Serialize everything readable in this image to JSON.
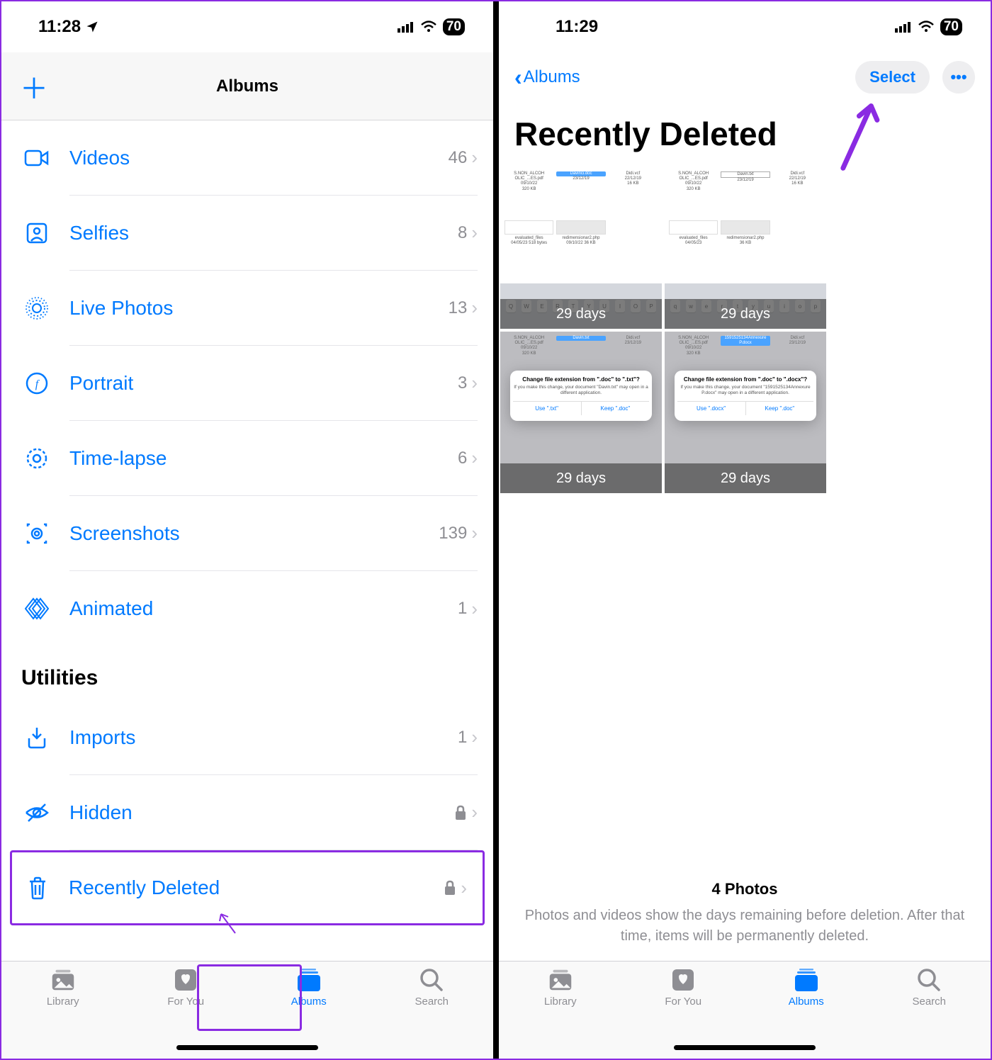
{
  "left": {
    "status": {
      "time": "11:28",
      "battery": "70"
    },
    "nav_title": "Albums",
    "media_types": [
      {
        "icon": "videos-icon",
        "label": "Videos",
        "count": "46"
      },
      {
        "icon": "selfies-icon",
        "label": "Selfies",
        "count": "8"
      },
      {
        "icon": "livephotos-icon",
        "label": "Live Photos",
        "count": "13"
      },
      {
        "icon": "portrait-icon",
        "label": "Portrait",
        "count": "3"
      },
      {
        "icon": "timelapse-icon",
        "label": "Time-lapse",
        "count": "6"
      },
      {
        "icon": "screenshots-icon",
        "label": "Screenshots",
        "count": "139"
      },
      {
        "icon": "animated-icon",
        "label": "Animated",
        "count": "1"
      }
    ],
    "section_utilities": "Utilities",
    "utilities": [
      {
        "icon": "imports-icon",
        "label": "Imports",
        "count": "1",
        "locked": false
      },
      {
        "icon": "hidden-icon",
        "label": "Hidden",
        "locked": true
      },
      {
        "icon": "trash-icon",
        "label": "Recently Deleted",
        "locked": true
      }
    ],
    "tabs": {
      "library": "Library",
      "foryou": "For You",
      "albums": "Albums",
      "search": "Search"
    }
  },
  "right": {
    "status": {
      "time": "11:29",
      "battery": "70"
    },
    "back_label": "Albums",
    "select_label": "Select",
    "title": "Recently Deleted",
    "thumbs": [
      {
        "days": "29 days"
      },
      {
        "days": "29 days"
      },
      {
        "days": "29 days"
      },
      {
        "days": "29 days"
      }
    ],
    "footer_count": "4 Photos",
    "footer_sub": "Photos and videos show the days remaining before deletion. After that time, items will be permanently deleted.",
    "tabs": {
      "library": "Library",
      "foryou": "For You",
      "albums": "Albums",
      "search": "Search"
    }
  }
}
